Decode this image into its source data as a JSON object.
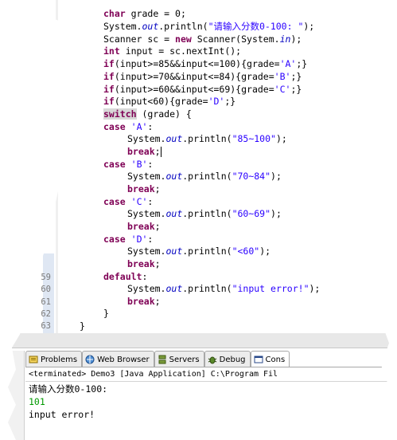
{
  "editor": {
    "line_numbers": [
      "59",
      "60",
      "61",
      "62",
      "63"
    ],
    "code": {
      "l1_a": "char",
      "l1_b": " grade = 0;",
      "l2_a": "System.",
      "l2_b": "out",
      "l2_c": ".println(",
      "l2_d": "\"请输入分数0-100: \"",
      "l2_e": ");",
      "l3_a": "Scanner sc = ",
      "l3_b": "new",
      "l3_c": " Scanner(System.",
      "l3_d": "in",
      "l3_e": ");",
      "l4_a": "int",
      "l4_b": " input = sc.nextInt();",
      "l5_a": "if",
      "l5_b": "(input>=85&&input<=100){grade=",
      "l5_c": "'A'",
      "l5_d": ";}",
      "l6_a": "if",
      "l6_b": "(input>=70&&input<=84){grade=",
      "l6_c": "'B'",
      "l6_d": ";}",
      "l7_a": "if",
      "l7_b": "(input>=60&&input<=69){grade=",
      "l7_c": "'C'",
      "l7_d": ";}",
      "l8_a": "if",
      "l8_b": "(input<60){grade=",
      "l8_c": "'D'",
      "l8_d": ";}",
      "l9_a": "switch",
      "l9_b": " (grade) {",
      "case_kw": "case",
      "case_a": "'A'",
      "case_b": "'B'",
      "case_c": "'C'",
      "case_d": "'D'",
      "colon": ":",
      "sys": "System.",
      "out": "out",
      "println": ".println(",
      "str_a": "\"85~100\"",
      "str_b": "\"70~84\"",
      "str_c": "\"60~69\"",
      "str_d": "\"<60\"",
      "str_err": "\"input error!\"",
      "close_paren": ");",
      "break_kw": "break",
      "semicolon": ";",
      "default_kw": "default",
      "close_brace": "}"
    }
  },
  "panel": {
    "tabs": [
      {
        "label": "Problems",
        "icon": "problems-icon"
      },
      {
        "label": "Web Browser",
        "icon": "globe-icon"
      },
      {
        "label": "Servers",
        "icon": "servers-icon"
      },
      {
        "label": "Debug",
        "icon": "debug-icon"
      },
      {
        "label": "Cons",
        "icon": "console-icon"
      }
    ],
    "terminated_text": "<terminated> Demo3 [Java Application] C:\\Program Fil",
    "console_lines": [
      "请输入分数0-100:",
      "101",
      "input error!"
    ],
    "input_color": "#009900"
  }
}
